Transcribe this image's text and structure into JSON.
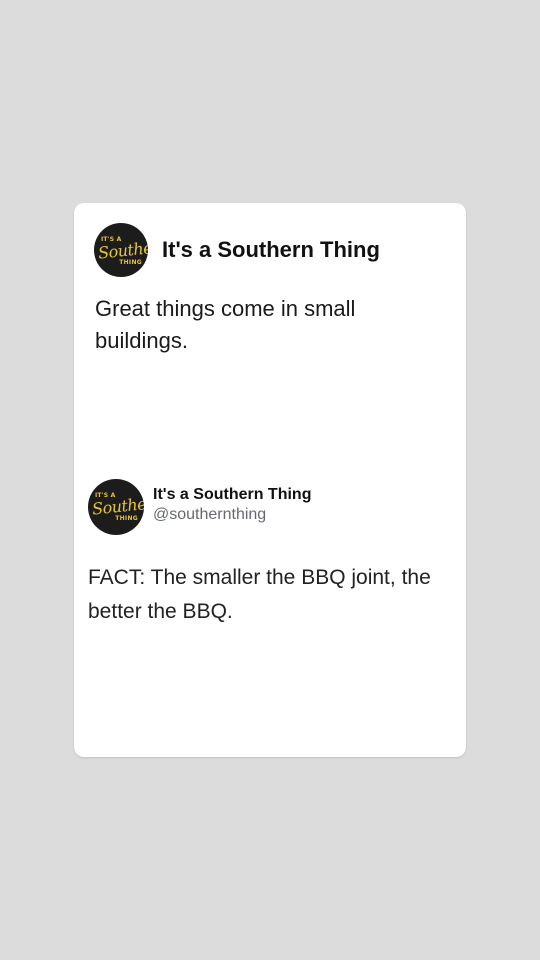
{
  "post": {
    "author_name": "It's a Southern Thing",
    "text": "Great things come in small buildings."
  },
  "logo": {
    "top_text": "IT'S A",
    "script_text": "Southern",
    "bottom_text": "THING",
    "accent_color": "#e7c436",
    "background_color": "#1c1c1c"
  },
  "tweet": {
    "author_name": "It's a Southern Thing",
    "handle": "@southernthing",
    "text": "FACT: The smaller the BBQ joint, the better the BBQ."
  }
}
